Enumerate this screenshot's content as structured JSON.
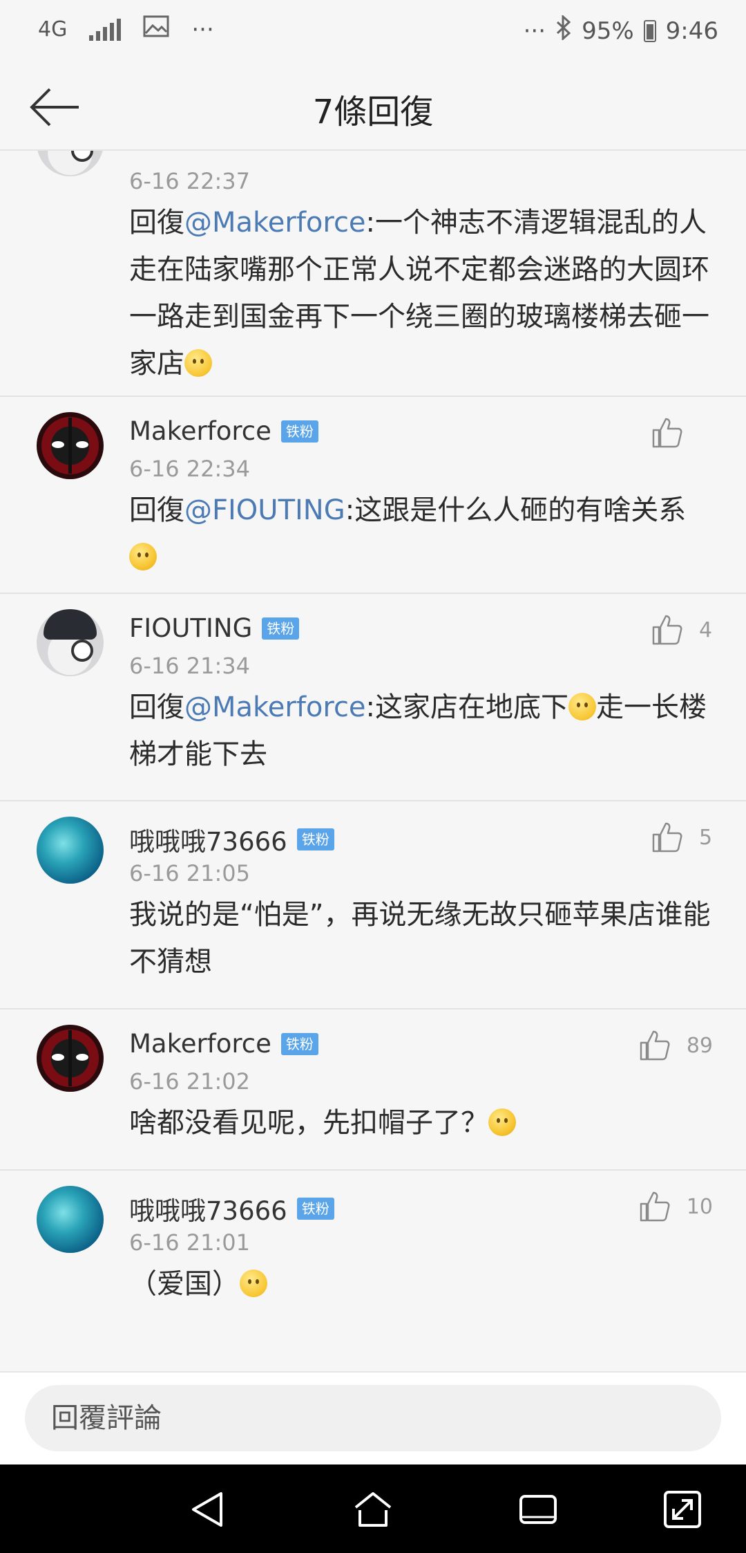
{
  "status_bar": {
    "network": "4G",
    "more_left": "···",
    "more_right": "···",
    "battery": "95%",
    "time": "9:46"
  },
  "header": {
    "title": "7條回復"
  },
  "replies": [
    {
      "username": "",
      "badge": "",
      "time": "6-16 22:37",
      "prefix": "回復",
      "mention": "@Makerforce",
      "text": ":一个神志不清逻辑混乱的人走在陆家嘴那个正常人说不定都会迷路的大圆环一路走到国金再下一个绕三圈的玻璃楼梯去砸一家店",
      "likes": ""
    },
    {
      "username": "Makerforce",
      "badge": "铁粉",
      "time": "6-16 22:34",
      "prefix": "回復",
      "mention": "@FIOUTING",
      "text": ":这跟是什么人砸的有啥关系",
      "likes": ""
    },
    {
      "username": "FIOUTING",
      "badge": "铁粉",
      "time": "6-16 21:34",
      "prefix": "回復",
      "mention": "@Makerforce",
      "text_a": ":这家店在地底下",
      "text_b": "走一长楼梯才能下去",
      "likes": "4"
    },
    {
      "username": "哦哦哦73666",
      "badge": "铁粉",
      "time": "6-16 21:05",
      "text": "我说的是“怕是”，再说无缘无故只砸苹果店谁能不猜想",
      "likes": "5"
    },
    {
      "username": "Makerforce",
      "badge": "铁粉",
      "time": "6-16 21:02",
      "text": "啥都没看见呢，先扣帽子了？",
      "likes": "89"
    },
    {
      "username": "哦哦哦73666",
      "badge": "铁粉",
      "time": "6-16 21:01",
      "text": "（爱国）",
      "likes": "10"
    }
  ],
  "input": {
    "placeholder": "回覆評論"
  },
  "icons": {
    "back": "back-arrow-icon",
    "like": "thumbs-up-icon",
    "nav_back": "nav-back-icon",
    "nav_home": "nav-home-icon",
    "nav_recent": "nav-recent-icon",
    "nav_expand": "nav-expand-icon"
  },
  "colors": {
    "mention": "#4b7ab4",
    "badge": "#5aa4ea",
    "background": "#f6f6f6"
  }
}
